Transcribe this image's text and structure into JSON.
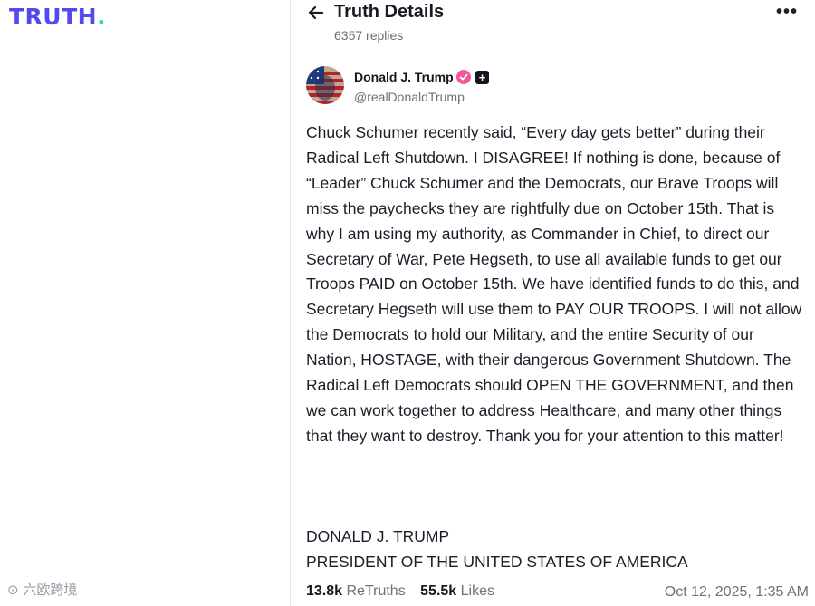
{
  "brand": {
    "logo_text": "TRUTH",
    "logo_dot": ".",
    "primary_color": "#5448ee",
    "accent_color": "#17e3b5"
  },
  "header": {
    "title": "Truth Details",
    "replies": "6357 replies",
    "back_icon": "arrow-left-icon",
    "more_icon": "more-horizontal-icon"
  },
  "author": {
    "name": "Donald J. Trump",
    "handle": "@realDonaldTrump",
    "verified_badge_color": "#f05a9b",
    "plus_icon": "plus-icon"
  },
  "post": {
    "text": "Chuck Schumer recently said, “Every day gets better” during their Radical Left Shutdown. I DISAGREE! If nothing is done, because of “Leader” Chuck Schumer and the Democrats, our Brave Troops will miss the paychecks they are rightfully due on October 15th. That is why I am using my authority, as Commander in Chief, to direct our Secretary of War, Pete Hegseth, to use all available funds to get our Troops PAID on October 15th. We have identified funds to do this, and Secretary Hegseth will use them to PAY OUR TROOPS. I will not allow the Democrats to hold our Military, and the entire Security of our Nation, HOSTAGE, with their dangerous Government Shutdown. The Radical Left Democrats should OPEN THE GOVERNMENT, and then we can work together to address Healthcare, and many other things that they want to destroy. Thank you for your attention to this matter!",
    "signature_name": "DONALD J. TRUMP",
    "signature_title": "PRESIDENT OF THE UNITED STATES OF AMERICA"
  },
  "stats": {
    "retruths_count": "13.8k",
    "retruths_label": "ReTruths",
    "likes_count": "55.5k",
    "likes_label": "Likes",
    "timestamp": "Oct 12, 2025, 1:35 AM"
  },
  "watermark": {
    "text": "六欧跨境"
  }
}
